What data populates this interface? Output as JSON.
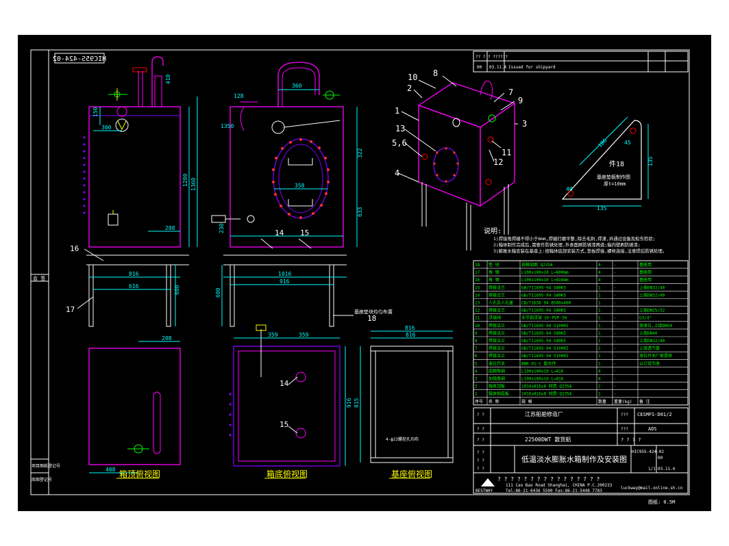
{
  "drawing": {
    "drawing_number": "HIC95S-424-02",
    "view_labels": {
      "top": "箱顶俯视图",
      "bottom": "箱底俯视图",
      "base": "基座俯视图",
      "detail": "件18",
      "detail_note1": "基座垫板制作图",
      "detail_note2": "厚t=10mm"
    },
    "dimensions": {
      "d150a": "150",
      "d300": "300",
      "d1280": "1280",
      "d1360": "1360",
      "d410": "410",
      "d208a": "208",
      "d208b": "208",
      "d816a": "816",
      "d616": "616",
      "d600a": "600",
      "d360": "360",
      "d128": "128",
      "d1350": "1350",
      "d322": "322",
      "d633": "633",
      "d358": "358",
      "d230": "230",
      "d1016": "1016",
      "d916": "916",
      "d816b": "816",
      "d600b": "600",
      "d408": "408",
      "d359a": "359",
      "d359b": "359",
      "d816c": "816",
      "d916b": "916",
      "d815": "815",
      "d45": "45",
      "d135a": "135",
      "d135b": "135",
      "d186": "186",
      "d40": "40"
    },
    "leaders": {
      "n14": "14",
      "n15": "15",
      "n16": "16",
      "n17": "17",
      "n18": "18",
      "n14b": "14",
      "n15b": "15",
      "note13": "基座垫块均匀布置",
      "note_base": "4-ф22螺栓孔均布",
      "iso": [
        "10",
        "8",
        "2",
        "1",
        "13",
        "5,6",
        "4",
        "7",
        "9",
        "3",
        "11",
        "12"
      ]
    },
    "notes": {
      "title": "说明:",
      "lines": [
        "1)焊接角焊缝不得小于6mm,焊缝打磨平整,除去毛刺,焊渣,并通过设备及船东检验;",
        "2)箱体制作完成后,需要作防锈处理,外表面刷防锈漆两道;箱内壁刷防锈漆;",
        "3)膨胀水箱安装在基座上:按箱体底部安装方式,垫板焊接,螺栓连接,注意焊后防锈处理。"
      ]
    },
    "bom": {
      "rows": [
        [
          "18",
          "垫 块",
          "规格如图 Q235A",
          "4",
          "-",
          "基座用"
        ],
        [
          "17",
          "角 钢",
          "L100x100x10 L=600mm",
          "4",
          "-",
          "基座用"
        ],
        [
          "16",
          "角 钢",
          "L100x100x10 L=816mm",
          "4",
          "-",
          "基座用"
        ],
        [
          "15",
          "焊接法兰",
          "GB/T11695-94 S80K5",
          "1",
          "-",
          "上接DN32/40"
        ],
        [
          "14",
          "焊接法兰",
          "GB/T11695-94 S80K5",
          "1",
          "-",
          "上接DN32/40"
        ],
        [
          "13",
          "人孔及人孔盖",
          "CB/T1636-94 B500x400",
          "1",
          "-",
          ""
        ],
        [
          "12",
          "焊接法兰",
          "GB/T11695-94 S80K5",
          "1",
          "-",
          "上接DN25/32"
        ],
        [
          "11",
          "浮球阀",
          "多节铜浮球 SF-PVP-30",
          "1",
          "-",
          "G3/4\""
        ],
        [
          "10",
          "焊接法兰",
          "GB/T11695-94 S100K5",
          "1",
          "-",
          "接液位,上接DN50"
        ],
        [
          "9",
          "焊接法兰",
          "GB/T11695-94 S80K5",
          "1",
          "-",
          "上接DN40"
        ],
        [
          "8",
          "焊接法兰",
          "GB/T11695-94 S80K5",
          "1",
          "-",
          "上接DN32/40"
        ],
        [
          "7",
          "焊接法兰",
          "GB/T11695-94 S100K5",
          "1",
          "-",
          "上接透气管"
        ],
        [
          "6",
          "焊接法兰",
          "GB/T11695-94 S100K5",
          "1",
          "-",
          "液位开关厂家提供"
        ],
        [
          "5",
          "液位开关",
          "BNK-01-C 配合件",
          "1",
          "-",
          "以订货为准"
        ],
        [
          "4",
          "底脚角钢",
          "L100x100x10 L=816",
          "4",
          "-",
          ""
        ],
        [
          "3",
          "加强角钢",
          "L100x100x10 L=816",
          "4",
          "-",
          ""
        ],
        [
          "2",
          "箱体顶板",
          "1016x816x8 材质:Q235A",
          "1",
          "-",
          ""
        ],
        [
          "1",
          "箱体侧底板",
          "1016x816x8 材质:Q235A",
          "1",
          "-",
          ""
        ]
      ],
      "header": [
        "序号",
        "名 称",
        "规 格",
        "数量",
        "重量(kg)",
        "备 注"
      ]
    },
    "title_block": {
      "rev_top_a": "?? ?    ?    ??????",
      "rev_row_no": "00",
      "rev_row_date": "03.11.4",
      "rev_row_desc": "Issued for shipyard",
      "company": "江苏船舶修造厂",
      "doc_code": "CESMFS-D01/2",
      "scale": "ADS",
      "ship": "22500DWT 散货船",
      "title": "低温淡水膨胀水箱制作及安装图",
      "drawing_no": "HIC95S-424-02",
      "rev": "00",
      "sheet": "1/1",
      "date": "03.11.4",
      "address": "111 Cao Bao Road Shanghai, CHINA   P.C.200233",
      "tel": "Tel:86-21-6436 5500  Fax:86-21-5448 7783",
      "email": "luckway@mail.online.sh.cn",
      "logo": "BESTWAY",
      "footer": "图纸: 0.5M",
      "left_stamp1": "项目图纸登记号",
      "left_stamp2": "底图登记号",
      "left_label": "会 签"
    }
  },
  "colors": {
    "background": "#000000",
    "border": "#ffffff",
    "tank": "#ff00ff",
    "tank_alt": "#8000ff",
    "dim": "#00ffff",
    "highlight": "#ffff00",
    "flange": "#ff0000",
    "green": "#00ff00"
  }
}
